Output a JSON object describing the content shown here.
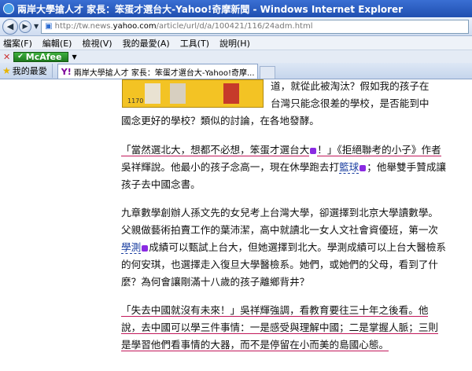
{
  "window": {
    "title": "兩岸大學搶人才 家長：笨蛋才選台大-Yahoo!奇摩新聞 - Windows Internet Explorer"
  },
  "address": {
    "url_prefix": "http://tw.news.",
    "url_domain": "yahoo.com",
    "url_rest": "/article/url/d/a/100421/116/24adm.html"
  },
  "menu": [
    "檔案(F)",
    "編輯(E)",
    "檢視(V)",
    "我的最愛(A)",
    "工具(T)",
    "說明(H)"
  ],
  "addon": {
    "label": "McAfee"
  },
  "tabs": {
    "favorites_label": "我的最愛",
    "active_tab_title": "兩岸大學搶人才 家長：笨蛋才選台大-Yahoo!奇摩..."
  },
  "article": {
    "image_caption": "1170",
    "lines": [
      "道，就從此被淘汰？假如我的孩子在",
      "台灣只能念很差的學校，是否能到中",
      "國念更好的學校？類似的討論，在各地發酵。",
      "「當然選北大，想都不必想，笨蛋才選台大",
      "！」《拒絕聯考的小子》作者",
      "吳祥輝說。他最小的孩子念高一，現在休學跑去打",
      "籃球",
      "；他舉雙手贊成讓",
      "孩子去中國念書。",
      "九章數學創辦人孫文先的女兒考上台灣大學，卻選擇到北京大學讀數學。",
      "父親做藝術拍賣工作的葉沛潔，高中就讀北一女人文社會資優班，第一次",
      "學測",
      "成績可以甄試上台大，但她選擇到北大。學測成績可以上台大醫檢系",
      "的何安琪，也選擇走入復旦大學醫檢系。她們，或她們的父母，看到了什",
      "麼？為何會讓剛滿十八歲的孩子離鄉背井？",
      "「失去中國就沒有未來！」吳祥輝強調，看教育要往三十年之後看。他",
      "說，去中國可以學三件事情：一是感受與理解中國；二是掌握人脈；三則",
      "是學習他們看事情的大器，而不是停留在小而美的島國心態。"
    ]
  },
  "colors": {
    "underline": "#c2185b",
    "keyword": "#1a3ea0",
    "mcafee": "#1e7a1e",
    "titlebar": "#1f4fb0"
  }
}
